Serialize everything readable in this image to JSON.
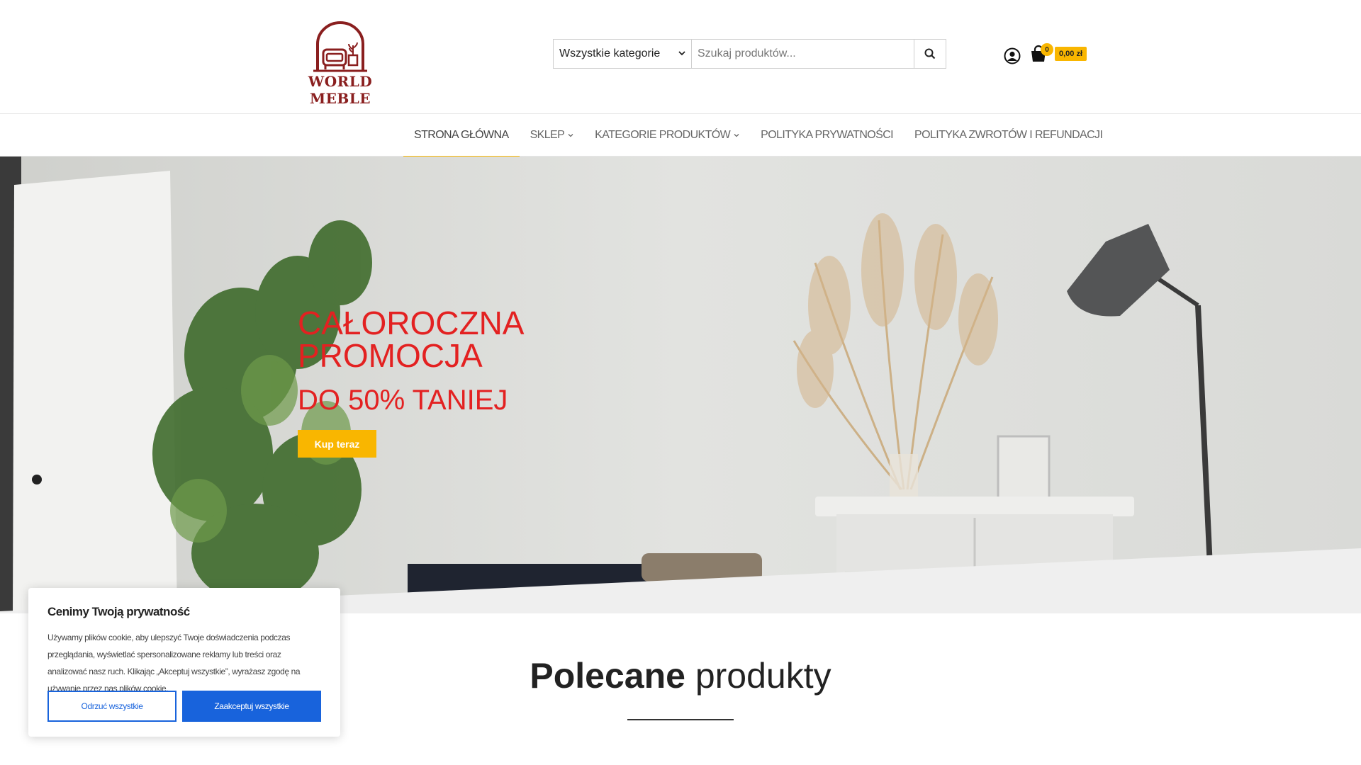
{
  "header": {
    "logo_text": "WORLD MEBLE",
    "search": {
      "category_selected": "Wszystkie kategorie",
      "placeholder": "Szukaj produktów..."
    },
    "cart": {
      "count": "0",
      "total": "0,00 zł"
    }
  },
  "nav": {
    "items": [
      {
        "label": "STRONA GŁÓWNA",
        "active": true,
        "has_submenu": false
      },
      {
        "label": "SKLEP",
        "active": false,
        "has_submenu": true
      },
      {
        "label": "KATEGORIE PRODUKTÓW",
        "active": false,
        "has_submenu": true
      },
      {
        "label": "POLITYKA PRYWATNOŚCI",
        "active": false,
        "has_submenu": false
      },
      {
        "label": "POLITYKA ZWROTÓW I REFUNDACJI",
        "active": false,
        "has_submenu": false
      }
    ]
  },
  "hero": {
    "title": "CAŁOROCZNA PROMOCJA",
    "subtitle": "DO 50% TANIEJ",
    "button": "Kup teraz"
  },
  "featured": {
    "title_bold": "Polecane",
    "title_light": "produkty"
  },
  "cookie": {
    "title": "Cenimy Twoją prywatność",
    "text": "Używamy plików cookie, aby ulepszyć Twoje doświadczenia podczas przeglądania, wyświetlać spersonalizowane reklamy lub treści oraz analizować nasz ruch. Klikając „Akceptuj wszystkie”, wyrażasz zgodę na używanie przez nas plików cookie.",
    "reject": "Odrzuć wszystkie",
    "accept": "Zaakceptuj wszystkie"
  },
  "colors": {
    "accent": "#f9b600",
    "promo_red": "#e32121",
    "logo_red": "#8a1f1f",
    "cookie_blue": "#1863dc"
  }
}
